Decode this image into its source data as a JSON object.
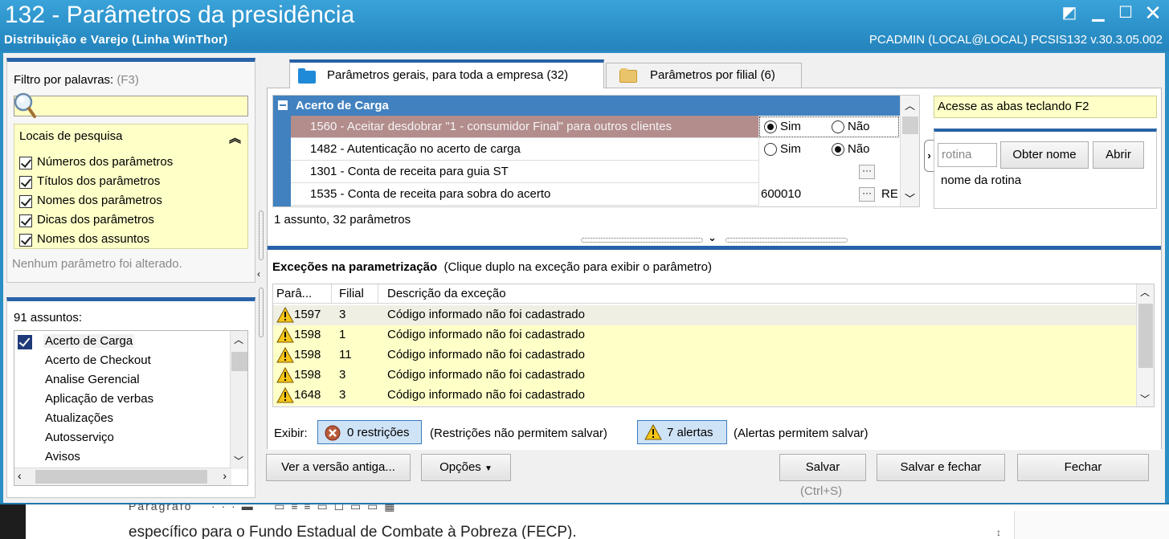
{
  "window": {
    "title": "132 - Parâmetros da presidência",
    "subtitle": "Distribuição e Varejo (Linha WinThor)",
    "user_info": "PCADMIN (LOCAL@LOCAL)   PCSIS132  v.30.3.05.002"
  },
  "filter": {
    "label": "Filtro por palavras:",
    "shortcut": "(F3)",
    "search_value": "",
    "locations_title": "Locais de pesquisa",
    "options": [
      {
        "label": "Números dos parâmetros",
        "checked": true
      },
      {
        "label": "Títulos dos parâmetros",
        "checked": true
      },
      {
        "label": "Nomes dos parâmetros",
        "checked": true
      },
      {
        "label": "Dicas dos parâmetros",
        "checked": true
      },
      {
        "label": "Nomes dos assuntos",
        "checked": true
      }
    ],
    "status": "Nenhum parâmetro foi alterado."
  },
  "subjects": {
    "count_label": "91 assuntos:",
    "items": [
      {
        "label": "Acerto de Carga",
        "checked": true
      },
      {
        "label": "Acerto de Checkout"
      },
      {
        "label": "Analise Gerencial"
      },
      {
        "label": "Aplicação de verbas"
      },
      {
        "label": "Atualizações"
      },
      {
        "label": "Autosserviço"
      },
      {
        "label": "Avisos"
      }
    ]
  },
  "tabs": [
    {
      "label": "Parâmetros gerais, para toda a empresa",
      "count": "(32)",
      "active": true
    },
    {
      "label": "Parâmetros por filial",
      "count": "(6)",
      "active": false
    }
  ],
  "grid": {
    "group_title": "Acerto de Carga",
    "rows": [
      {
        "title": "1560 - Aceitar desdobrar \"1 - consumidor Final\" para outros clientes",
        "kind": "radio",
        "yes": "Sim",
        "no": "Não",
        "selected": "yes"
      },
      {
        "title": "1482 - Autenticação no acerto de carga",
        "kind": "radio",
        "yes": "Sim",
        "no": "Não",
        "selected": "no"
      },
      {
        "title": "1301 - Conta de receita para guia ST",
        "kind": "lookup",
        "value": ""
      },
      {
        "title": "1535 - Conta de receita para sobra do acerto",
        "kind": "lookup",
        "value": "600010",
        "suffix": "RE"
      }
    ],
    "summary": "1 assunto, 32 parâmetros",
    "ellipsis": "···"
  },
  "side": {
    "tip": "Acesse as abas teclando F2",
    "rotina_placeholder": "rotina",
    "get_name_button": "Obter nome",
    "open_button": "Abrir",
    "rotina_name": "nome da rotina"
  },
  "exceptions": {
    "title": "Exceções na parametrização",
    "hint": "(Clique duplo na exceção para exibir o parâmetro)",
    "columns": [
      "Parâ...",
      "Filial",
      "Descrição da exceção"
    ],
    "rows": [
      {
        "param": "1597",
        "filial": "3",
        "desc": "Código informado não foi cadastrado"
      },
      {
        "param": "1598",
        "filial": "1",
        "desc": "Código informado não foi cadastrado"
      },
      {
        "param": "1598",
        "filial": "11",
        "desc": "Código informado não foi cadastrado"
      },
      {
        "param": "1598",
        "filial": "3",
        "desc": "Código informado não foi cadastrado"
      },
      {
        "param": "1648",
        "filial": "3",
        "desc": "Código informado não foi cadastrado"
      }
    ],
    "show_label": "Exibir:",
    "restrictions_button": "0 restrições",
    "restrictions_note": "(Restrições não permitem salvar)",
    "alerts_button": "7 alertas",
    "alerts_note": "(Alertas permitem salvar)"
  },
  "footer": {
    "old_version": "Ver a versão antiga...",
    "options": "Opções",
    "save": "Salvar",
    "save_shortcut": "(Ctrl+S)",
    "save_close": "Salvar e fechar",
    "close": "Fechar"
  },
  "background": {
    "toolbar_fragment": "Parágrafo",
    "text": "específico para o Fundo Estadual de Combate à Pobreza (FECP)."
  },
  "colors": {
    "title_blue": "#2b8ec4",
    "accent_blue": "#2862a8",
    "group_header": "#4181bf",
    "selected_row": "#b38c8c",
    "yellow_panel": "#ffffc8"
  }
}
